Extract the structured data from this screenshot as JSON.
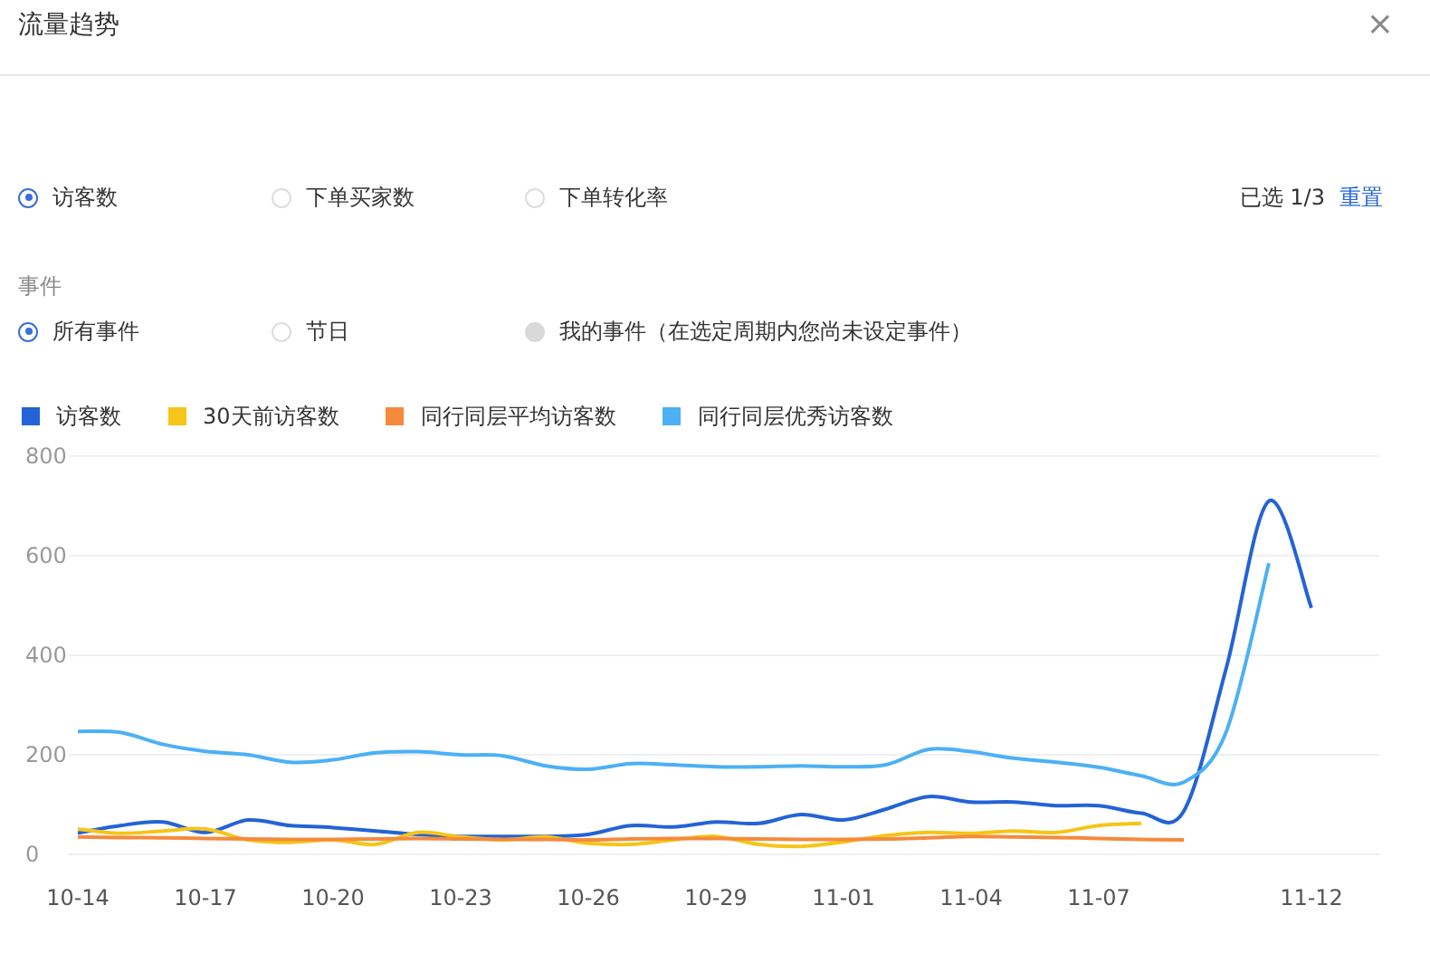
{
  "dialog": {
    "title": "流量趋势",
    "close": "×"
  },
  "metrics": {
    "options": [
      {
        "label": "访客数",
        "selected": true
      },
      {
        "label": "下单买家数",
        "selected": false
      },
      {
        "label": "下单转化率",
        "selected": false
      }
    ],
    "selection_info": "已选 1/3",
    "reset": "重置"
  },
  "events": {
    "label": "事件",
    "options": [
      {
        "label": "所有事件",
        "selected": true,
        "disabled": false
      },
      {
        "label": "节日",
        "selected": false,
        "disabled": false
      },
      {
        "label": "我的事件（在选定周期内您尚未设定事件）",
        "selected": false,
        "disabled": true
      }
    ]
  },
  "chart_data": {
    "type": "line",
    "categories": [
      "10-14",
      null,
      null,
      "10-17",
      null,
      null,
      "10-20",
      null,
      null,
      "10-23",
      null,
      null,
      "10-26",
      null,
      null,
      "10-29",
      null,
      null,
      "11-01",
      null,
      null,
      "11-04",
      null,
      null,
      "11-07",
      null,
      null,
      null,
      null,
      "11-12"
    ],
    "grid": true,
    "series": [
      {
        "name": "访客数",
        "color": "#2463d6",
        "values": [
          43,
          58,
          65,
          44,
          69,
          58,
          54,
          47,
          40,
          36,
          36,
          36,
          40,
          58,
          55,
          65,
          62,
          80,
          69,
          91,
          116,
          105,
          105,
          98,
          98,
          83,
          87,
          375,
          710,
          495
        ]
      },
      {
        "name": "30天前访客数",
        "color": "#f5c518",
        "values": [
          51,
          42,
          47,
          51,
          29,
          24,
          29,
          20,
          44,
          35,
          29,
          35,
          22,
          20,
          29,
          36,
          20,
          16,
          25,
          38,
          44,
          42,
          47,
          44,
          58,
          62,
          null,
          null,
          null,
          null
        ]
      },
      {
        "name": "同行同层平均访客数",
        "color": "#f58a3c",
        "values": [
          35,
          34,
          33,
          32,
          31,
          30,
          30,
          31,
          32,
          31,
          30,
          30,
          29,
          31,
          32,
          32,
          31,
          30,
          30,
          31,
          33,
          36,
          35,
          34,
          32,
          30,
          29,
          null,
          null,
          null
        ]
      },
      {
        "name": "同行同层优秀访客数",
        "color": "#4cb0f5",
        "values": [
          247,
          245,
          221,
          207,
          200,
          185,
          190,
          204,
          206,
          200,
          198,
          178,
          171,
          182,
          180,
          176,
          176,
          178,
          176,
          180,
          211,
          206,
          193,
          185,
          175,
          158,
          145,
          247,
          585,
          null
        ]
      }
    ],
    "ylim": [
      0,
      800
    ],
    "yticks": [
      0,
      200,
      400,
      600,
      800
    ]
  }
}
